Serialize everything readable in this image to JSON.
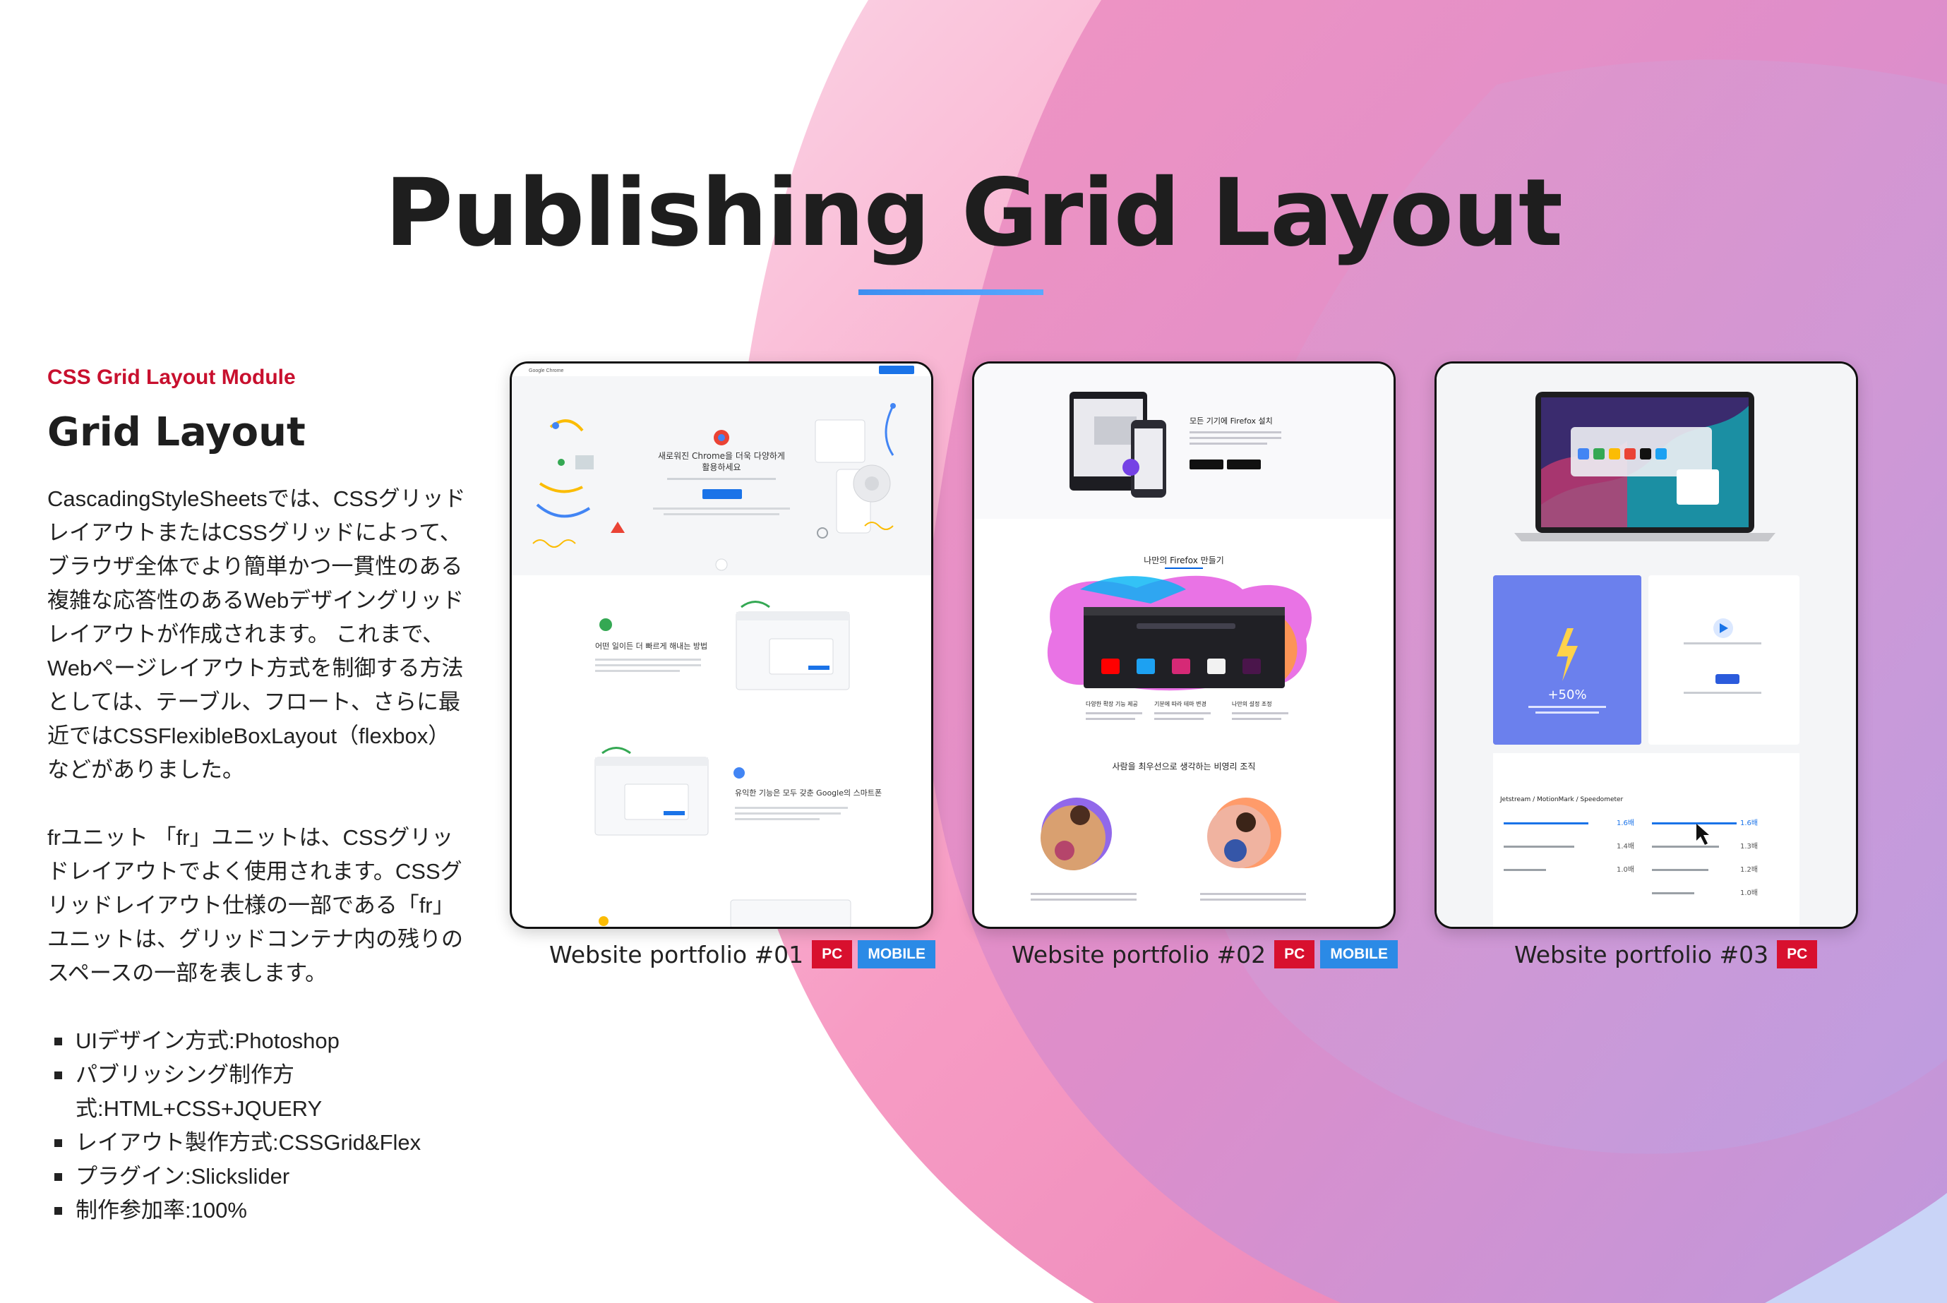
{
  "title": "Publishing Grid Layout",
  "intro": {
    "module_label": "CSS Grid Layout Module",
    "heading": "Grid Layout",
    "paragraph_1": "CascadingStyleSheetsでは、CSSグリッドレイアウトまたはCSSグリッドによって、ブラウザ全体でより簡単かつ一貫性のある複雑な応答性のあるWebデザイングリッドレイアウトが作成されます。 これまで、Webページレイアウト方式を制御する方法としては、テーブル、フロート、さらに最近ではCSSFlexibleBoxLayout（flexbox）などがありました。",
    "paragraph_2": "frユニット 「fr」ユニットは、CSSグリッドレイアウトでよく使用されます。CSSグリッドレイアウト仕様の一部である「fr」ユニットは、グリッドコンテナ内の残りのスペースの一部を表します。",
    "specs": [
      "UIデザイン方式:Photoshop",
      "パブリッシング制作方式:HTML+CSS+JQUERY",
      "レイアウト製作方式:CSSGrid&Flex",
      "プラグイン:Slickslider",
      "制作参加率:100%"
    ]
  },
  "portfolios": [
    {
      "caption": "Website portfolio #01",
      "tags": [
        "PC",
        "MOBILE"
      ],
      "preview": {
        "brand": "Google Chrome",
        "hero_line_1": "새로워진 Chrome을 더욱 다양하게",
        "hero_line_2": "활용하세요",
        "section_1": "어떤 일이든 더 빠르게 해내는 방법",
        "section_2": "유익한 기능은 모두 갖춘 Google의 스마트폰"
      }
    },
    {
      "caption": "Website portfolio #02",
      "tags": [
        "PC",
        "MOBILE"
      ],
      "preview": {
        "hero": "모든 기기에 Firefox 설치",
        "heading_1": "나만의 Firefox 만들기",
        "heading_2": "사람을 최우선으로 생각하는 비영리 조직",
        "col_1": "다양한 확장 기능 제공",
        "col_2": "기분에 따라 테마 변경",
        "col_3": "나만의 설정 조정"
      }
    },
    {
      "caption": "Website portfolio #03",
      "tags": [
        "PC"
      ],
      "preview": {
        "stat": "+50%",
        "bench_title": "Jetstream / MotionMark / Speedometer",
        "v1": "1.6배",
        "v2": "1.4배",
        "v3": "1.0배",
        "v4": "1.6배",
        "v5": "1.3배",
        "v6": "1.2배",
        "v7": "1.0배"
      }
    }
  ],
  "colors": {
    "accent_red": "#d8102e",
    "accent_blue": "#2b8ae6",
    "module_label": "#c8102e"
  }
}
